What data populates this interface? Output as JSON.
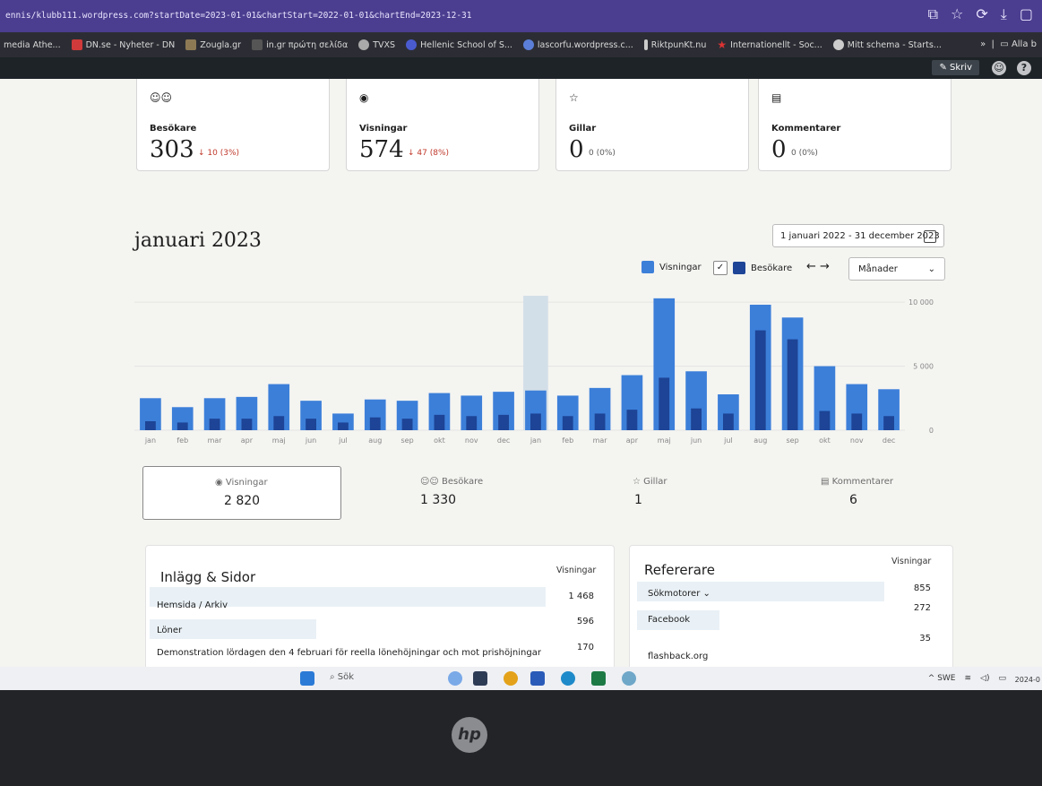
{
  "browser": {
    "url": "ennis/klubb111.wordpress.com?startDate=2023-01-01&chartStart=2022-01-01&chartEnd=2023-12-31",
    "bookmarks": [
      "media Athe...",
      "DN.se - Nyheter - DN",
      "Zougla.gr",
      "in.gr πρώτη σελίδα",
      "TVXS",
      "Hellenic School of S...",
      "lascorfu.wordpress.c...",
      "RiktpunKt.nu",
      "Internationellt - Soc...",
      "Mitt schema - Starts..."
    ],
    "bookmarks_more": "»",
    "all_bookmarks": "Alla b"
  },
  "wp_toolbar": {
    "write_label": "Skriv"
  },
  "stat_cards": [
    {
      "label": "Besökare",
      "value": "303",
      "change": "↓ 10 (3%)",
      "icon": "people-icon"
    },
    {
      "label": "Visningar",
      "value": "574",
      "change": "↓ 47 (8%)",
      "icon": "eye-icon"
    },
    {
      "label": "Gillar",
      "value": "0",
      "change": "0 (0%)",
      "icon": "star-icon"
    },
    {
      "label": "Kommentarer",
      "value": "0",
      "change": "0 (0%)",
      "icon": "comment-icon"
    }
  ],
  "chart_header": {
    "title": "januari 2023",
    "date_range": "1 januari 2022 - 31 december 2023",
    "legend_views": "Visningar",
    "legend_visitors": "Besökare",
    "period_select": "Månader",
    "arrows": "← →"
  },
  "colors": {
    "views": "#3c7fd9",
    "visitors": "#1d4496",
    "highlight": "#d3dfe8",
    "accent": "#1e1e1e"
  },
  "chart_data": {
    "type": "bar",
    "categories": [
      "jan",
      "feb",
      "mar",
      "apr",
      "maj",
      "jun",
      "jul",
      "aug",
      "sep",
      "okt",
      "nov",
      "dec",
      "jan",
      "feb",
      "mar",
      "apr",
      "maj",
      "jun",
      "jul",
      "aug",
      "sep",
      "okt",
      "nov",
      "dec"
    ],
    "series": [
      {
        "name": "Visningar",
        "values": [
          2500,
          1800,
          2500,
          2600,
          3600,
          2300,
          1300,
          2400,
          2300,
          2900,
          2700,
          3000,
          3100,
          2700,
          3300,
          4300,
          10300,
          4600,
          2800,
          9800,
          8800,
          5000,
          3600,
          3200
        ]
      },
      {
        "name": "Besökare",
        "values": [
          700,
          600,
          900,
          900,
          1100,
          900,
          600,
          1000,
          900,
          1200,
          1100,
          1200,
          1300,
          1100,
          1300,
          1600,
          4100,
          1700,
          1300,
          7800,
          7100,
          1500,
          1300,
          1100
        ]
      }
    ],
    "highlight_index": 12,
    "y_ticks": [
      "10 000",
      "5 000",
      "0"
    ],
    "y_tick_values": [
      10000,
      5000,
      0
    ],
    "ylim": [
      0,
      10500
    ]
  },
  "totals": [
    {
      "label": "Visningar",
      "value": "2 820",
      "icon": "eye-icon"
    },
    {
      "label": "Besökare",
      "value": "1 330",
      "icon": "people-icon"
    },
    {
      "label": "Gillar",
      "value": "1",
      "icon": "star-icon"
    },
    {
      "label": "Kommentarer",
      "value": "6",
      "icon": "comment-icon"
    }
  ],
  "posts_panel": {
    "title": "Inlägg & Sidor",
    "col_header": "Visningar",
    "rows": [
      {
        "title": "Hemsida / Arkiv",
        "views": "1 468"
      },
      {
        "title": "Löner",
        "views": "596"
      },
      {
        "title": "Demonstration lördagen den 4 februari för reella lönehöjningar och mot prishöjningar",
        "views": "170"
      }
    ]
  },
  "referrers_panel": {
    "title": "Refererare",
    "col_header": "Visningar",
    "rows": [
      {
        "title": "Sökmotorer ⌄",
        "views": "855"
      },
      {
        "title": "Facebook",
        "views": "272"
      },
      {
        "title": "flashback.org",
        "views": "35"
      }
    ]
  },
  "taskbar": {
    "search_label": "Sök",
    "tray_text": "^  SWE",
    "date": "2024-0"
  },
  "laptop": {
    "logo": "hp"
  }
}
